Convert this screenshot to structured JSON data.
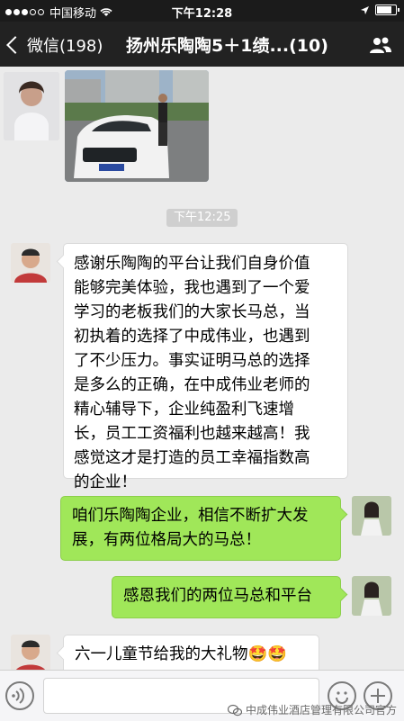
{
  "status": {
    "carrier": "中国移动",
    "time": "下午12:28"
  },
  "nav": {
    "back_label": "微信(198)",
    "title": "扬州乐陶陶5＋1绩...(10)"
  },
  "chat": {
    "timestamp": "下午12:25",
    "messages": [
      {
        "side": "left",
        "text": "感谢乐陶陶的平台让我们自身价值\n能够完美体验，我也遇到了一个爱\n学习的老板我们的大家长马总，当\n初执着的选择了中成伟业，也遇到\n了不少压力。事实证明马总的选择\n是多么的正确，在中成伟业老师的\n精心辅导下，企业纯盈利飞速增\n长，员工工资福利也越来越高！我\n感觉这才是打造的员工幸福指数高\n的企业！"
      },
      {
        "side": "right",
        "text": "咱们乐陶陶企业，相信不断扩大发\n展，有两位格局大的马总！"
      },
      {
        "side": "right",
        "text": "感恩我们的两位马总和平台"
      },
      {
        "side": "left",
        "text": "六一儿童节给我的大礼物🤩🤩"
      }
    ]
  },
  "watermark": "中成伟业酒店管理有限公司官方",
  "colors": {
    "nav_bg": "#222222",
    "chat_bg": "#ebebeb",
    "green_bubble": "#a0e759",
    "white_bubble": "#ffffff"
  }
}
